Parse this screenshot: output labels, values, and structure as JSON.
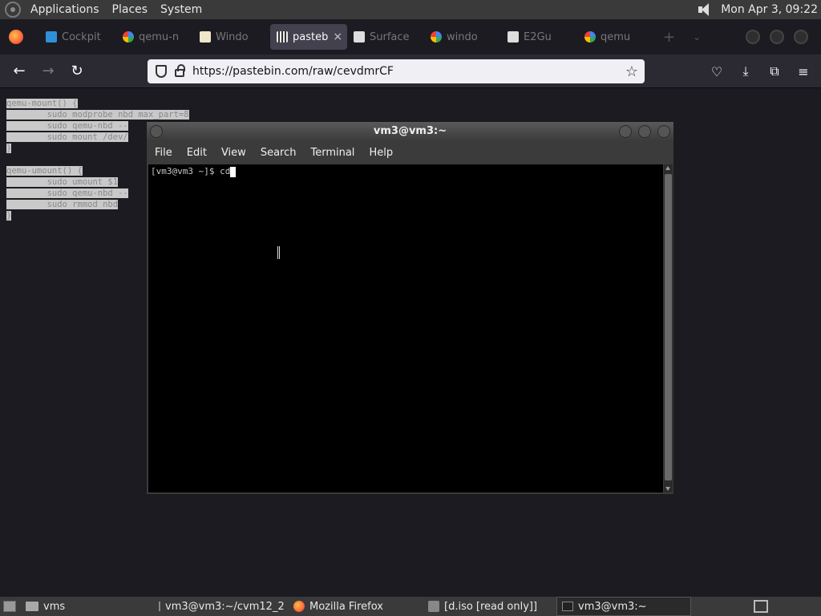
{
  "top_panel": {
    "menus": [
      "Applications",
      "Places",
      "System"
    ],
    "clock": "Mon Apr  3, 09:22"
  },
  "browser": {
    "tabs": [
      {
        "icon": "monitor-icon",
        "label": "Cockpit"
      },
      {
        "icon": "google-icon",
        "label": "qemu-n"
      },
      {
        "icon": "ba-icon",
        "label": "Windo"
      },
      {
        "icon": "pastebin-icon",
        "label": "pasteb",
        "active": true
      },
      {
        "icon": "bank-icon",
        "label": "Surface"
      },
      {
        "icon": "google-icon",
        "label": "windo"
      },
      {
        "icon": "bank-icon",
        "label": "E2Gu"
      },
      {
        "icon": "google-icon",
        "label": "qemu"
      }
    ],
    "url": "https://pastebin.com/raw/cevdmrCF"
  },
  "paste_lines": [
    "qemu-mount() {",
    "        sudo modprobe nbd max_part=8",
    "        sudo qemu-nbd --",
    "        sudo mount /dev/",
    "}",
    "",
    "qemu-umount() {",
    "        sudo umount $1",
    "        sudo qemu-nbd --",
    "        sudo rmmod nbd",
    "}"
  ],
  "terminal": {
    "title": "vm3@vm3:~",
    "menu": [
      "File",
      "Edit",
      "View",
      "Search",
      "Terminal",
      "Help"
    ],
    "prompt": "[vm3@vm3 ~]$ ",
    "input": "cd"
  },
  "taskbar": {
    "items": [
      {
        "icon": "folder-icon",
        "label": "vms"
      },
      {
        "icon": "terminal-icon",
        "label": "vm3@vm3:~/cvm12_2"
      },
      {
        "icon": "firefox-icon",
        "label": "Mozilla Firefox"
      },
      {
        "icon": "disk-icon",
        "label": "[d.iso [read only]]"
      },
      {
        "icon": "terminal-icon",
        "label": "vm3@vm3:~",
        "active": true
      }
    ]
  }
}
